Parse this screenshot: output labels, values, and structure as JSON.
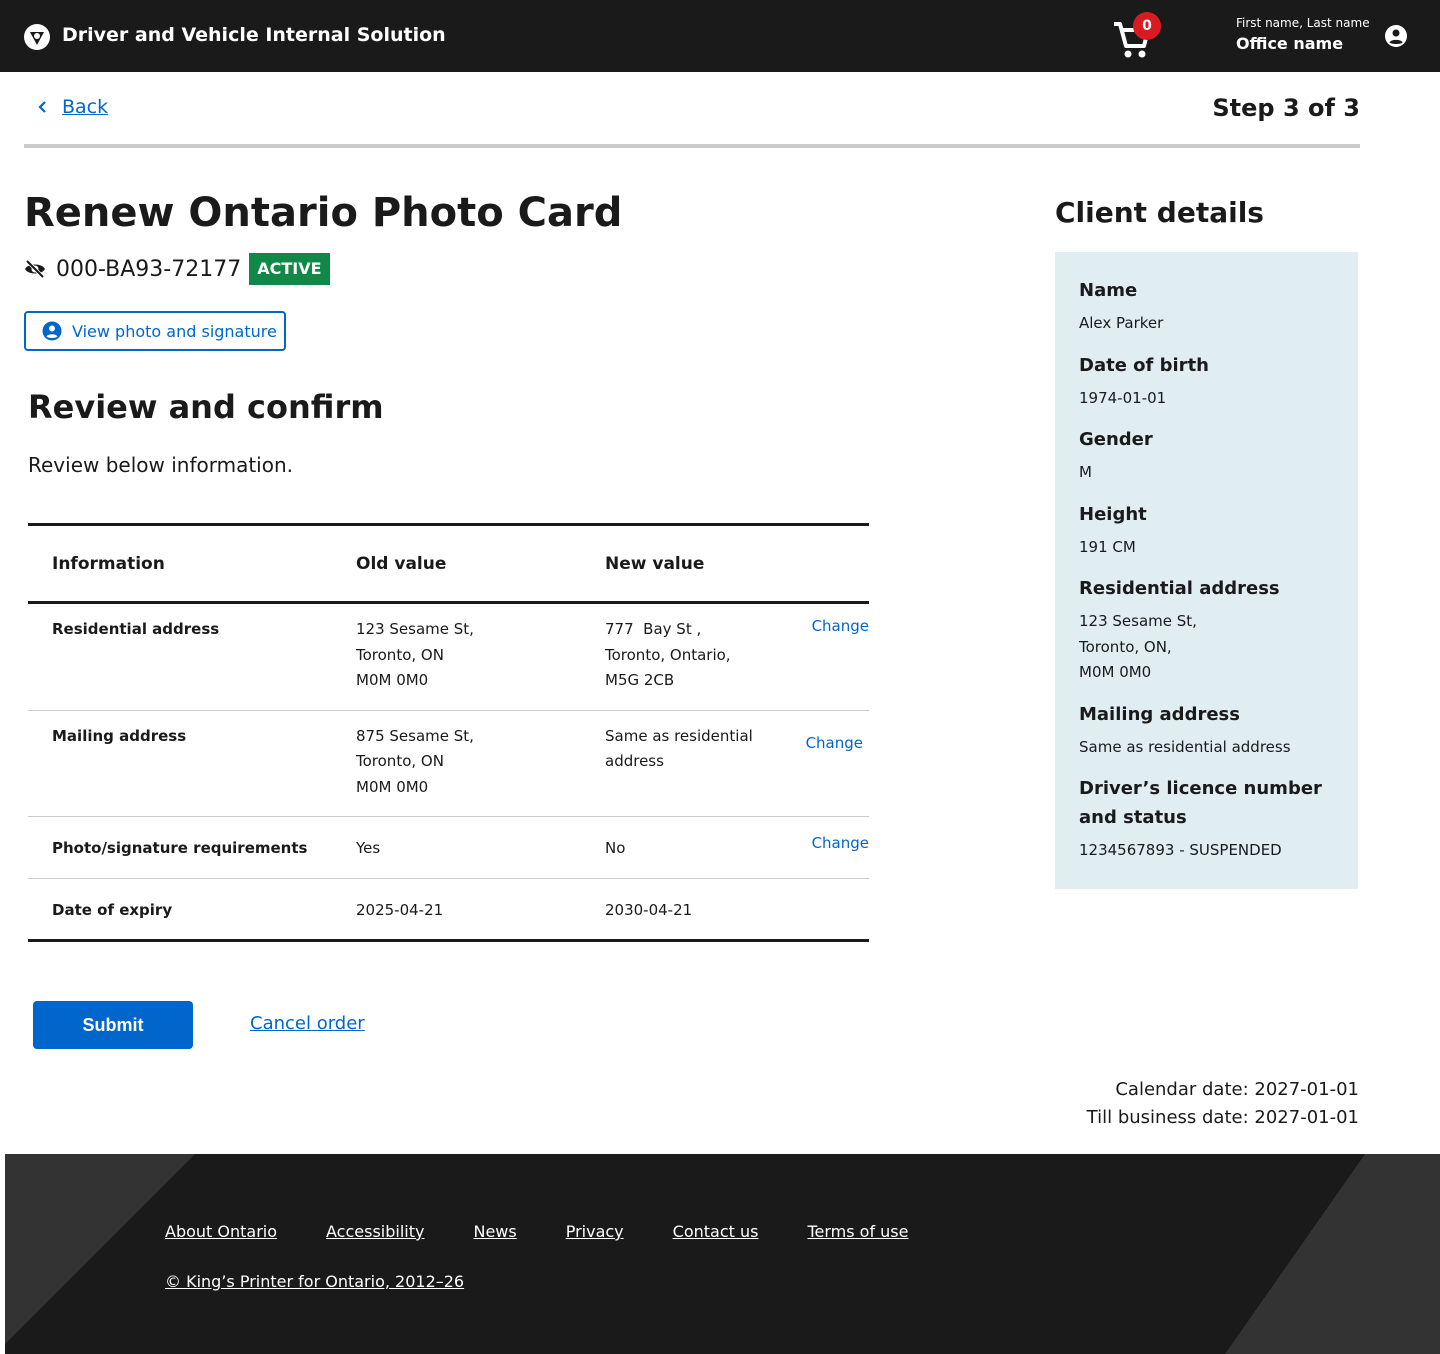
{
  "header": {
    "app_title": "Driver and Vehicle Internal Solution",
    "cart_count": "0",
    "user_name": "First name, Last name",
    "office_name": "Office name"
  },
  "nav": {
    "back_label": "Back",
    "step": "Step 3 of 3"
  },
  "main": {
    "title": "Renew Ontario Photo Card",
    "card_number": "000-BA93-72177",
    "card_status": "ACTIVE",
    "view_photo_label": "View photo and signature",
    "section_title": "Review and confirm",
    "section_desc": "Review below information."
  },
  "table": {
    "headers": [
      "Information",
      "Old value",
      "New value"
    ],
    "rows": [
      {
        "info": "Residential address",
        "old": [
          "123 Sesame St,",
          "Toronto, ON",
          "M0M 0M0"
        ],
        "new": [
          "777  Bay St ,",
          "Toronto, Ontario,",
          "M5G 2CB"
        ],
        "action": "Change"
      },
      {
        "info": "Mailing address",
        "old": [
          "875 Sesame St,",
          "Toronto, ON",
          "M0M 0M0"
        ],
        "new": [
          "Same as residential",
          "address"
        ],
        "action": "Change"
      },
      {
        "info": "Photo/signature requirements",
        "old": [
          "Yes"
        ],
        "new": [
          "No"
        ],
        "action": "Change"
      },
      {
        "info": "Date of expiry",
        "old": [
          "2025-04-21"
        ],
        "new": [
          "2030-04-21"
        ],
        "action": ""
      }
    ]
  },
  "actions": {
    "submit_label": "Submit",
    "cancel_label": "Cancel order"
  },
  "client": {
    "title": "Client details",
    "fields": [
      {
        "label": "Name",
        "value": [
          "Alex Parker"
        ]
      },
      {
        "label": "Date of birth",
        "value": [
          "1974-01-01"
        ]
      },
      {
        "label": "Gender",
        "value": [
          "M"
        ]
      },
      {
        "label": "Height",
        "value": [
          "191 CM"
        ]
      },
      {
        "label": "Residential address",
        "value": [
          "123 Sesame St,",
          "Toronto, ON,",
          "M0M 0M0"
        ]
      },
      {
        "label": "Mailing address",
        "value": [
          "Same as residential address"
        ]
      },
      {
        "label": "Driver’s licence number and status",
        "value": [
          "1234567893 - SUSPENDED"
        ]
      }
    ]
  },
  "dates": {
    "calendar": "Calendar date: 2027-01-01",
    "till": "Till business date: 2027-01-01"
  },
  "footer": {
    "links": [
      "About Ontario",
      "Accessibility",
      "News",
      "Privacy",
      "Contact us",
      "Terms of use"
    ],
    "copyright": "© King’s Printer for Ontario, 2012–26"
  },
  "colors": {
    "header_bg": "#1a1a1a",
    "link_blue": "#0066cc",
    "active_green": "#118847",
    "badge_red": "#d81a21",
    "panel_bg": "#e0eef2",
    "footer_bg": "#1a1a1a"
  },
  "icons": {
    "logo": "ontario-trillium-icon",
    "cart": "shopping-cart-icon",
    "account": "account-circle-icon",
    "back": "chevron-left-icon",
    "masked": "eye-off-icon",
    "photo": "account-circle-icon"
  }
}
